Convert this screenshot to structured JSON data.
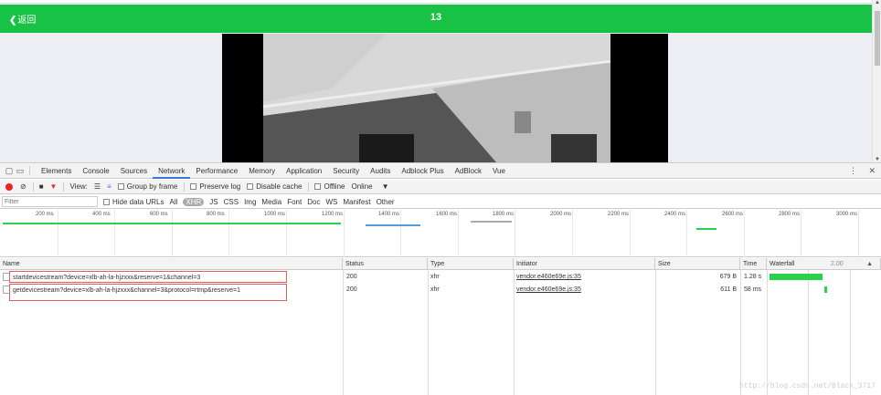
{
  "app": {
    "back_label": "返回",
    "title": "13"
  },
  "devtools": {
    "tabs": [
      "Elements",
      "Console",
      "Sources",
      "Network",
      "Performance",
      "Memory",
      "Application",
      "Security",
      "Audits",
      "Adblock Plus",
      "AdBlock",
      "Vue"
    ],
    "active_tab": "Network",
    "toolbar": {
      "view_label": "View:",
      "group_by_frame": "Group by frame",
      "preserve_log": "Preserve log",
      "disable_cache": "Disable cache",
      "offline": "Offline",
      "throttle": "Online"
    },
    "filter": {
      "placeholder": "Filter",
      "hide_data_urls": "Hide data URLs",
      "types": [
        "All",
        "XHR",
        "JS",
        "CSS",
        "Img",
        "Media",
        "Font",
        "Doc",
        "WS",
        "Manifest",
        "Other"
      ],
      "selected_type": "XHR"
    },
    "overview_ticks": [
      "200 ms",
      "400 ms",
      "600 ms",
      "800 ms",
      "1000 ms",
      "1200 ms",
      "1400 ms",
      "1600 ms",
      "1800 ms",
      "2000 ms",
      "2200 ms",
      "2400 ms",
      "2600 ms",
      "2800 ms",
      "3000 ms"
    ],
    "columns": {
      "name": "Name",
      "status": "Status",
      "type": "Type",
      "initiator": "Initiator",
      "size": "Size",
      "time": "Time",
      "waterfall": "Waterfall",
      "waterfall_scale": "2.00"
    },
    "requests": [
      {
        "name": "startdevicestream?device=xlb-ah-la-hjzxxx&reserve=1&channel=3",
        "status": "200",
        "type": "xhr",
        "initiator": "vendor.e460e69e.js:35",
        "size": "679 B",
        "time": "1.28 s",
        "waterfall_start": 0.0,
        "waterfall_fraction": 0.58
      },
      {
        "name": "getdevicestream?device=xlb-ah-la-hjzxxx&channel=3&protocol=rtmp&reserve=1",
        "status": "200",
        "type": "xhr",
        "initiator": "vendor.e460e69e.js:35",
        "size": "611 B",
        "time": "58 ms",
        "waterfall_start": 0.6,
        "waterfall_fraction": 0.03
      }
    ]
  },
  "watermark": "http://blog.csdn.net/Black_3717",
  "colors": {
    "appbar": "#17c245",
    "waterfall": "#29d24a",
    "record": "#ee2222"
  }
}
